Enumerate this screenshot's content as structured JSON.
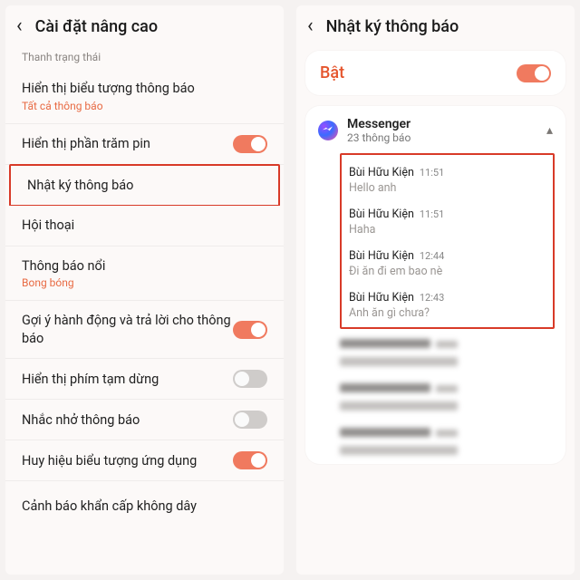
{
  "left": {
    "title": "Cài đặt nâng cao",
    "section": "Thanh trạng thái",
    "rows": {
      "icons": {
        "title": "Hiển thị biểu tượng thông báo",
        "sub": "Tất cả thông báo"
      },
      "battery": {
        "title": "Hiển thị phần trăm pin"
      },
      "log": {
        "title": "Nhật ký thông báo"
      },
      "convo": {
        "title": "Hội thoại"
      },
      "float": {
        "title": "Thông báo nổi",
        "sub": "Bong bóng"
      },
      "suggest": {
        "title": "Gợi ý hành động và trả lời cho thông báo"
      },
      "pause": {
        "title": "Hiển thị phím tạm dừng"
      },
      "remind": {
        "title": "Nhắc nhở thông báo"
      },
      "badge": {
        "title": "Huy hiệu biểu tượng ứng dụng"
      },
      "emerg": {
        "title": "Cảnh báo khẩn cấp không dây"
      }
    }
  },
  "right": {
    "title": "Nhật ký thông báo",
    "on_label": "Bật",
    "group": {
      "name": "Messenger",
      "count": "23 thông báo"
    },
    "messages": [
      {
        "from": "Bùi Hữu Kiện",
        "time": "11:51",
        "body": "Hello anh"
      },
      {
        "from": "Bùi Hữu Kiện",
        "time": "11:51",
        "body": "Haha"
      },
      {
        "from": "Bùi Hữu Kiện",
        "time": "12:44",
        "body": "Đi ăn đi em bao nè"
      },
      {
        "from": "Bùi Hữu Kiện",
        "time": "12:43",
        "body": "Anh ăn gì chưa?"
      }
    ]
  }
}
